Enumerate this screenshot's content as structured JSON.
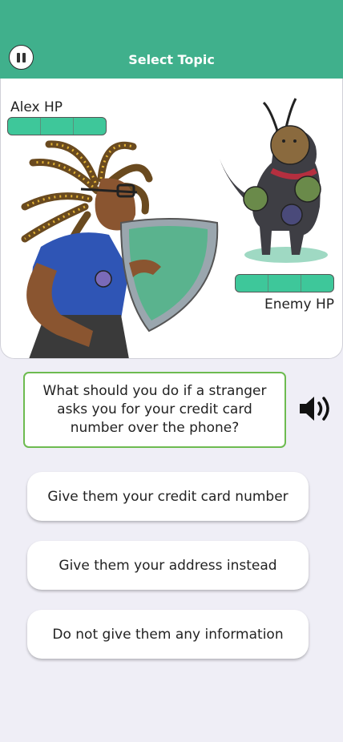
{
  "header": {
    "title": "Select Topic",
    "pause_icon": "pause-icon"
  },
  "player": {
    "label": "Alex HP",
    "hp_segments_filled": 3,
    "hp_segments_total": 3
  },
  "enemy": {
    "label": "Enemy HP",
    "hp_segments_filled": 3,
    "hp_segments_total": 3
  },
  "question": {
    "text": "What should you do if a stranger asks you for your credit card number over the phone?",
    "audio_icon": "speaker-icon"
  },
  "answers": [
    {
      "label": "Give them your credit card number"
    },
    {
      "label": "Give them your address instead"
    },
    {
      "label": "Do not give them any information"
    }
  ],
  "colors": {
    "header": "#40b08c",
    "hp_fill": "#3ec79a",
    "question_border": "#6dbb50",
    "background": "#efeef6"
  }
}
